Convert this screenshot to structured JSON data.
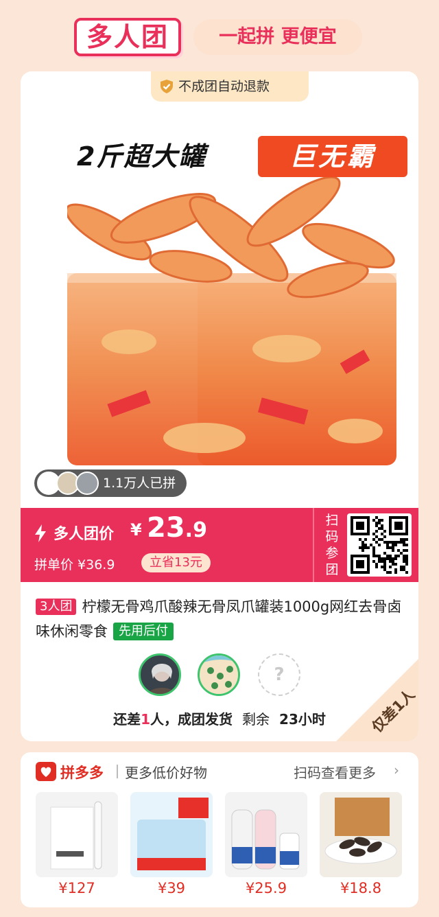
{
  "header": {
    "logo_text": "多人团",
    "slogan": "一起拼 更便宜"
  },
  "card": {
    "refund_badge": "不成团自动退款",
    "banner_left": "2斤超大罐",
    "banner_right": "巨无霸",
    "joined_count": "1.1万人已拼",
    "price": {
      "group_label": "多人团价",
      "currency": "¥",
      "group_price_int": "23",
      "group_price_dec": ".9",
      "single_label": "拼单价 ¥36.9",
      "saved": "立省13元",
      "scan_label": "扫码参团"
    },
    "title": {
      "tag": "3人团",
      "text": "柠檬无骨鸡爪酸辣无骨凤爪罐装1000g网红去骨卤味休闲零食",
      "pay_tag": "先用后付"
    },
    "empty_slot_symbol": "?",
    "status": {
      "prefix": "还差",
      "count": "1",
      "suffix": "人，成团发货",
      "remain_label": "剩余",
      "remain_time": "23小时"
    },
    "ribbon": "仅差1人"
  },
  "recommend": {
    "brand": "拼多多",
    "tagline": "更多低价好物",
    "more": "扫码查看更多",
    "arrow": "›",
    "products": [
      {
        "price": "¥127"
      },
      {
        "price": "¥39"
      },
      {
        "price": "¥25.9"
      },
      {
        "price": "¥18.8"
      }
    ]
  },
  "colors": {
    "brand_pink": "#e9305a",
    "page_bg": "#fbe6d7",
    "pdd_red": "#e02e24",
    "pay_green": "#19a546"
  }
}
